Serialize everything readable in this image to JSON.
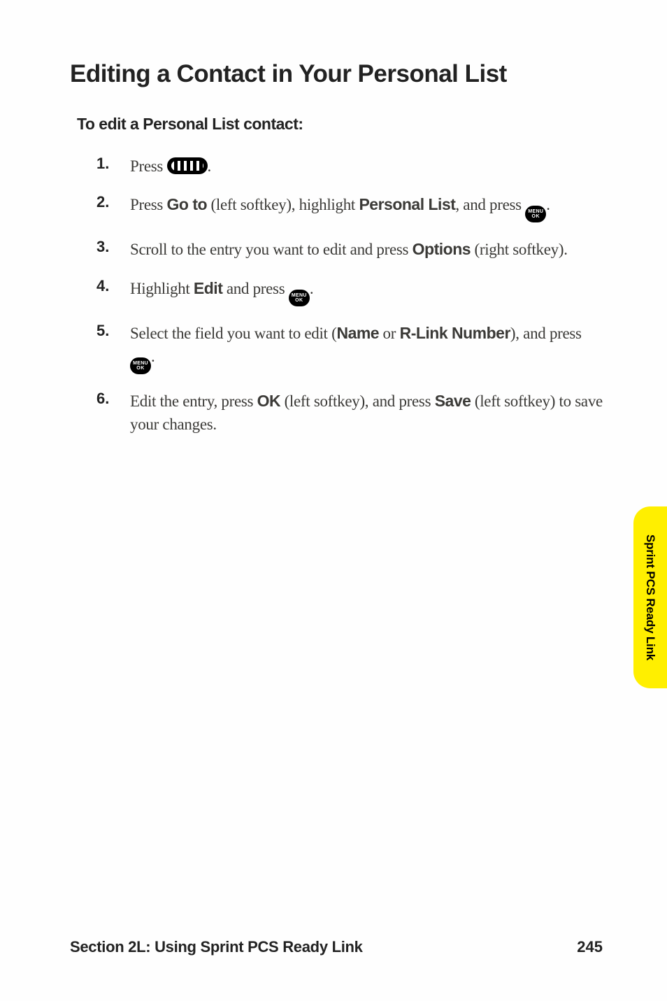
{
  "heading": "Editing a Contact in Your Personal List",
  "subheading": "To edit a Personal List contact:",
  "steps": [
    {
      "num": "1.",
      "pre": "Press ",
      "icon": "pill",
      "post": "."
    },
    {
      "num": "2.",
      "parts": [
        "Press ",
        {
          "b": "Go to"
        },
        " (left softkey), highlight ",
        {
          "b": "Personal List"
        },
        ", and press ",
        {
          "icon": "menu"
        },
        "."
      ]
    },
    {
      "num": "3.",
      "parts": [
        "Scroll to the entry you want to edit and press ",
        {
          "b": "Options"
        },
        " (right softkey)."
      ]
    },
    {
      "num": "4.",
      "parts": [
        "Highlight ",
        {
          "b": "Edit"
        },
        " and press ",
        {
          "icon": "menu"
        },
        "."
      ]
    },
    {
      "num": "5.",
      "parts": [
        "Select the field you want to edit (",
        {
          "b": "Name"
        },
        " or ",
        {
          "b": "R-Link Number"
        },
        "), and press ",
        {
          "icon": "menu"
        },
        "."
      ]
    },
    {
      "num": "6.",
      "parts": [
        "Edit the entry, press ",
        {
          "b": "OK"
        },
        " (left softkey), and press ",
        {
          "b": "Save"
        },
        " (left softkey) to save your changes."
      ]
    }
  ],
  "tab": "Sprint PCS Ready Link",
  "footer": {
    "section": "Section 2L: Using Sprint PCS Ready Link",
    "page": "245"
  },
  "icons": {
    "pill": "ready-link-button",
    "menu": "MENU OK"
  }
}
